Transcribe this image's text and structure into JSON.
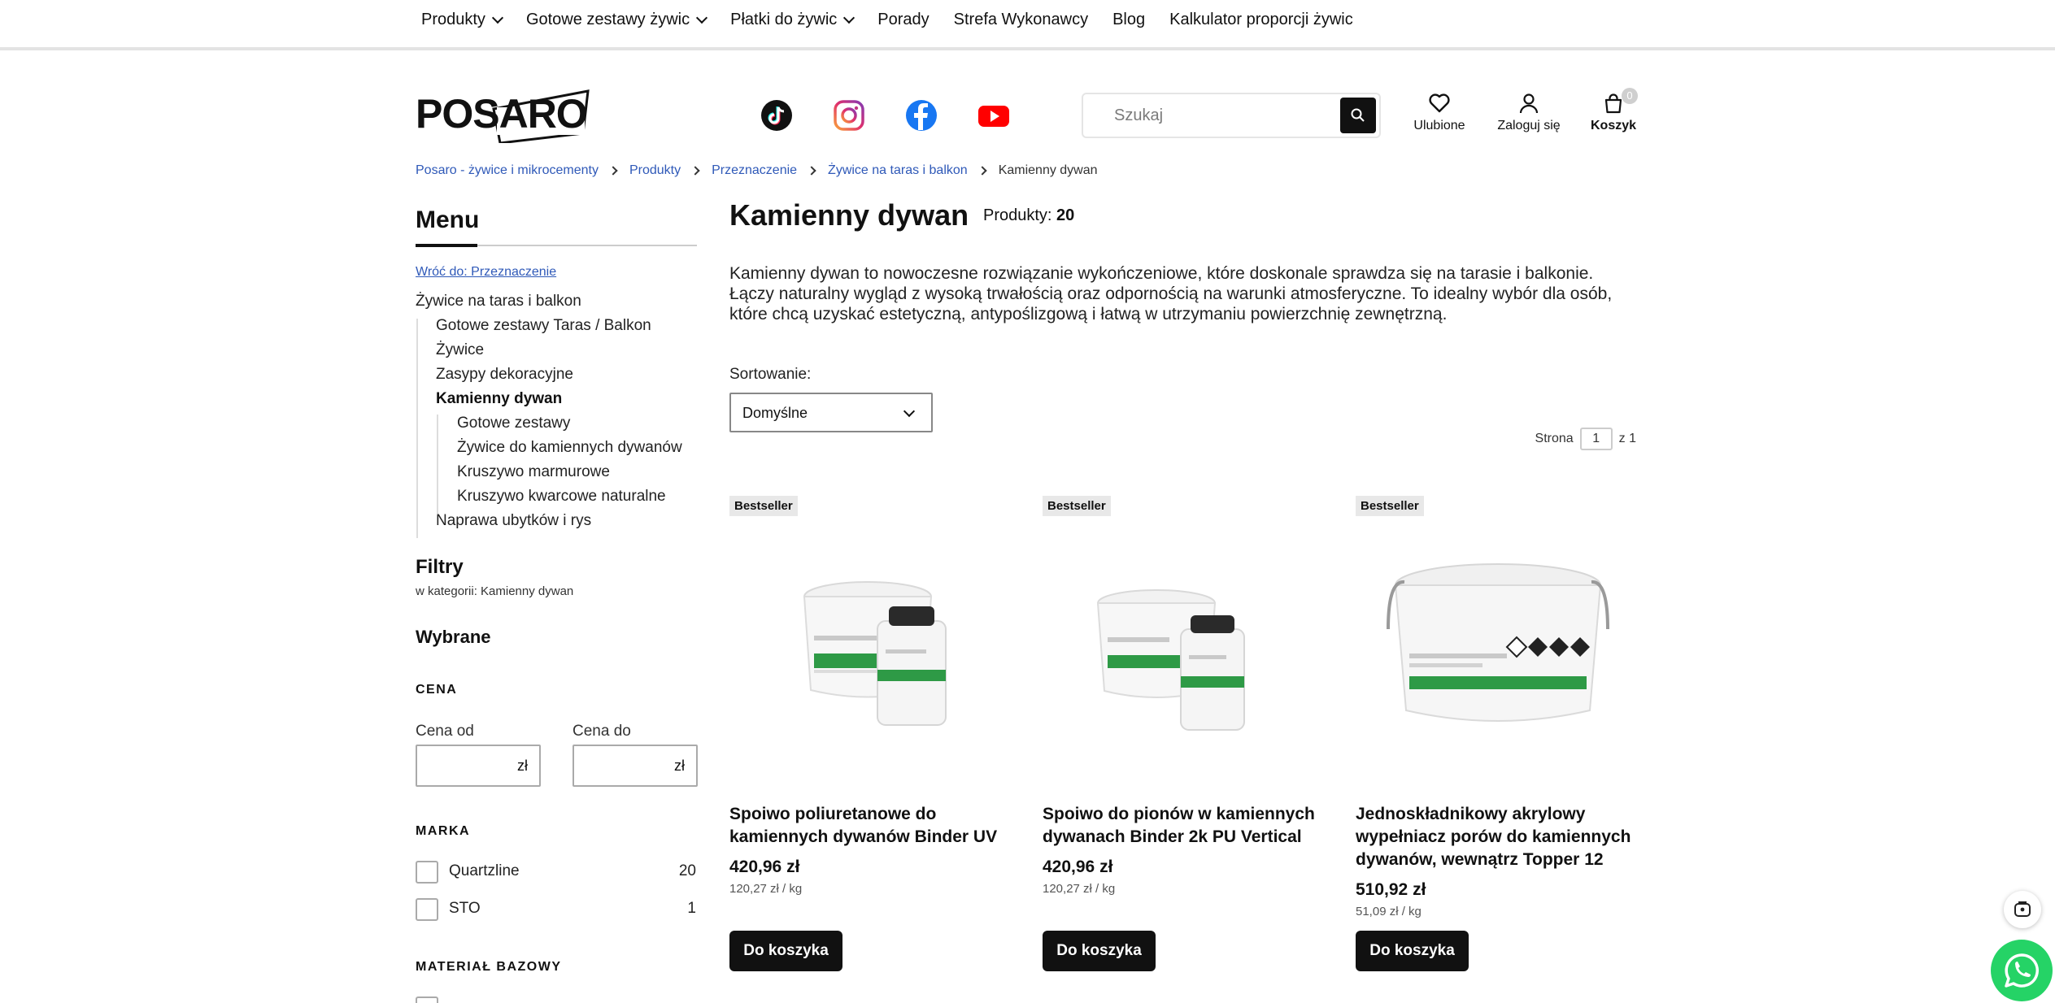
{
  "topnav": {
    "items": [
      {
        "label": "Produkty",
        "dropdown": true
      },
      {
        "label": "Gotowe zestawy żywic",
        "dropdown": true
      },
      {
        "label": "Płatki do żywic",
        "dropdown": true
      },
      {
        "label": "Porady",
        "dropdown": false
      },
      {
        "label": "Strefa Wykonawcy",
        "dropdown": false
      },
      {
        "label": "Blog",
        "dropdown": false
      },
      {
        "label": "Kalkulator proporcji żywic",
        "dropdown": false
      }
    ]
  },
  "header": {
    "logo_text": "POSARO",
    "social_icons": [
      "tiktok-icon",
      "instagram-icon",
      "facebook-icon",
      "youtube-icon"
    ],
    "search_placeholder": "Szukaj",
    "favorites_label": "Ulubione",
    "login_label": "Zaloguj się",
    "cart_label": "Koszyk",
    "cart_count": "0"
  },
  "breadcrumb": {
    "items": [
      "Posaro - żywice i mikrocementy",
      "Produkty",
      "Przeznaczenie",
      "Żywice na taras i balkon"
    ],
    "current": "Kamienny dywan"
  },
  "sidebar": {
    "menu_title": "Menu",
    "back_link": "Wróć do: Przeznaczenie",
    "items": [
      {
        "label": "Żywice na taras i balkon",
        "level": 0,
        "active": false
      },
      {
        "label": "Gotowe zestawy Taras / Balkon",
        "level": 1,
        "active": false
      },
      {
        "label": "Żywice",
        "level": 1,
        "active": false
      },
      {
        "label": "Zasypy dekoracyjne",
        "level": 1,
        "active": false
      },
      {
        "label": "Kamienny dywan",
        "level": 1,
        "active": true
      },
      {
        "label": "Gotowe zestawy",
        "level": 2,
        "active": false
      },
      {
        "label": "Żywice do kamiennych dywanów",
        "level": 2,
        "active": false
      },
      {
        "label": "Kruszywo marmurowe",
        "level": 2,
        "active": false
      },
      {
        "label": "Kruszywo kwarcowe naturalne",
        "level": 2,
        "active": false
      },
      {
        "label": "Naprawa ubytków i rys",
        "level": 1,
        "active": false
      }
    ],
    "filters_title": "Filtry",
    "filters_sub": "w kategorii: Kamienny dywan",
    "selected_title": "Wybrane",
    "price_section": "CENA",
    "price_from_label": "Cena od",
    "price_to_label": "Cena do",
    "currency": "zł",
    "brand_section": "MARKA",
    "brands": [
      {
        "name": "Quartzline",
        "count": "20"
      },
      {
        "name": "STO",
        "count": "1"
      }
    ],
    "material_section": "MATERIAŁ BAZOWY"
  },
  "main": {
    "title": "Kamienny dywan",
    "products_label": "Produkty:",
    "products_count": "20",
    "description": "Kamienny dywan to nowoczesne rozwiązanie wykończeniowe, które doskonale sprawdza się na tarasie i balkonie. Łączy naturalny wygląd z wysoką trwałością oraz odpornością na warunki atmosferyczne. To idealny wybór dla osób, które chcą uzyskać estetyczną, antypoślizgową i łatwą w utrzymaniu powierzchnię zewnętrzną.",
    "sort_label": "Sortowanie:",
    "sort_value": "Domyślne",
    "page_label": "Strona",
    "page_current": "1",
    "page_total": "z 1"
  },
  "products": [
    {
      "badge": "Bestseller",
      "name": "Spoiwo poliuretanowe do kamiennych dywanów Binder UV",
      "price": "420,96 zł",
      "unit_price": "120,27 zł / kg",
      "button": "Do koszyka"
    },
    {
      "badge": "Bestseller",
      "name": "Spoiwo do pionów w kamiennych dywanach Binder 2k PU Vertical",
      "price": "420,96 zł",
      "unit_price": "120,27 zł / kg",
      "button": "Do koszyka"
    },
    {
      "badge": "Bestseller",
      "name": "Jednoskładnikowy akrylowy wypełniacz porów do kamiennych dywanów, wewnątrz Topper 12",
      "price": "510,92 zł",
      "unit_price": "51,09 zł / kg",
      "button": "Do koszyka"
    }
  ],
  "colors": {
    "link": "#2f59b8",
    "button_bg": "#111111",
    "badge_bg": "#e8e8e8",
    "whatsapp": "#25d366"
  }
}
